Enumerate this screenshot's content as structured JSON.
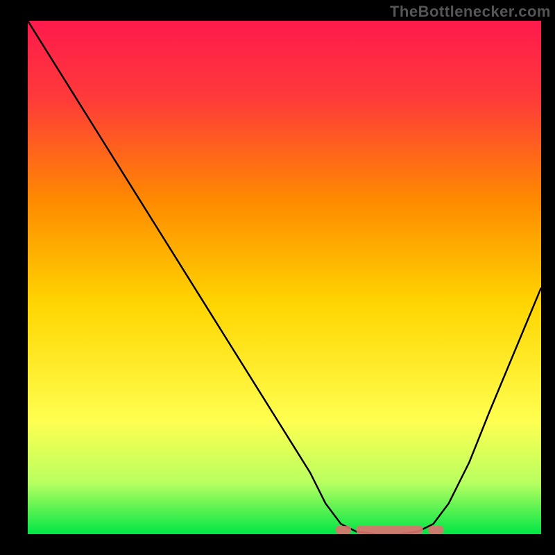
{
  "watermark": "TheBottlenecker.com",
  "chart_data": {
    "type": "line",
    "title": "",
    "xlabel": "",
    "ylabel": "",
    "xlim": [
      0,
      100
    ],
    "ylim": [
      0,
      100
    ],
    "background_gradient": {
      "top": "#ff1a4d",
      "mid": "#ffd500",
      "bottom": "#00e645"
    },
    "curve": {
      "description": "V-shaped bottleneck curve",
      "points": [
        {
          "x": 0,
          "y": 100
        },
        {
          "x": 5,
          "y": 92
        },
        {
          "x": 10,
          "y": 84
        },
        {
          "x": 15,
          "y": 76
        },
        {
          "x": 20,
          "y": 68
        },
        {
          "x": 25,
          "y": 60
        },
        {
          "x": 30,
          "y": 52
        },
        {
          "x": 35,
          "y": 44
        },
        {
          "x": 40,
          "y": 36
        },
        {
          "x": 45,
          "y": 28
        },
        {
          "x": 50,
          "y": 20
        },
        {
          "x": 55,
          "y": 12
        },
        {
          "x": 58,
          "y": 6
        },
        {
          "x": 61,
          "y": 2
        },
        {
          "x": 64,
          "y": 0.5
        },
        {
          "x": 68,
          "y": 0
        },
        {
          "x": 72,
          "y": 0
        },
        {
          "x": 76,
          "y": 0.5
        },
        {
          "x": 79,
          "y": 2
        },
        {
          "x": 82,
          "y": 6
        },
        {
          "x": 86,
          "y": 14
        },
        {
          "x": 90,
          "y": 24
        },
        {
          "x": 95,
          "y": 36
        },
        {
          "x": 100,
          "y": 48
        }
      ]
    },
    "marker_band": {
      "color": "#e07070",
      "segments": [
        {
          "x_start": 60,
          "x_end": 63
        },
        {
          "x_start": 64,
          "x_end": 77
        },
        {
          "x_start": 78,
          "x_end": 81
        }
      ],
      "y": 0.8
    }
  }
}
